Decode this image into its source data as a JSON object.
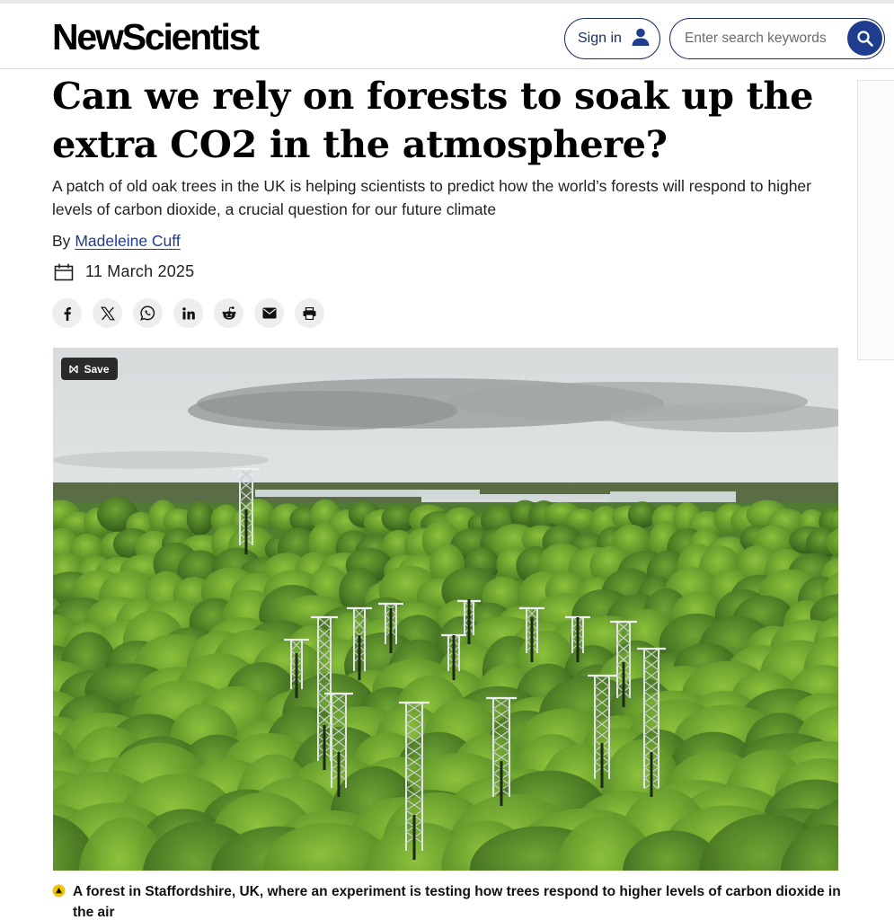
{
  "header": {
    "logo": "NewScientist",
    "signin_label": "Sign in",
    "search_placeholder": "Enter search keywords"
  },
  "article": {
    "headline": "Can we rely on forests to soak up the extra CO2 in the atmosphere?",
    "standfirst": "A patch of old oak trees in the UK is helping scientists to predict how the world’s forests will respond to higher levels of carbon dioxide, a crucial question for our future climate",
    "byline_prefix": "By",
    "author": "Madeleine Cuff",
    "date": "11 March 2025",
    "save_label": "Save",
    "caption": "A forest in Staffordshire, UK, where an experiment is testing how trees respond to higher levels of carbon dioxide in the air"
  },
  "share_icons": [
    "facebook-icon",
    "x-icon",
    "whatsapp-icon",
    "linkedin-icon",
    "reddit-icon",
    "email-icon",
    "print-icon"
  ],
  "colors": {
    "brand_navy": "#1f3d8f",
    "text": "#111111",
    "share_bg": "#eeeeee",
    "caption_marker": "#f5c400"
  }
}
